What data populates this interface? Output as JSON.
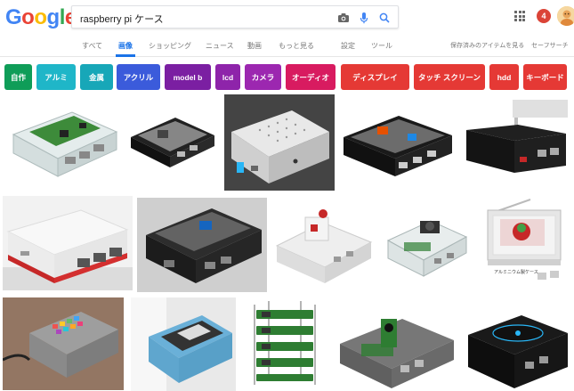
{
  "header": {
    "logo_letters": [
      {
        "char": "G",
        "color": "#4285F4"
      },
      {
        "char": "o",
        "color": "#EA4335"
      },
      {
        "char": "o",
        "color": "#FBBC05"
      },
      {
        "char": "g",
        "color": "#4285F4"
      },
      {
        "char": "l",
        "color": "#34A853"
      },
      {
        "char": "e",
        "color": "#EA4335"
      }
    ],
    "search_query": "raspberry pi ケース",
    "notification_count": "4"
  },
  "tabs": {
    "all": "すべて",
    "images": "画像",
    "shopping": "ショッピング",
    "news": "ニュース",
    "videos": "動画",
    "more": "もっと見る",
    "settings": "設定",
    "tools": "ツール",
    "saved": "保存済みのアイテムを見る",
    "safesearch": "セーフサーチ"
  },
  "chips": [
    {
      "label": "自作",
      "color": "#0f9d58"
    },
    {
      "label": "アルミ",
      "color": "#1fb6c8"
    },
    {
      "label": "金属",
      "color": "#17a7b8"
    },
    {
      "label": "アクリル",
      "color": "#3b5bdb"
    },
    {
      "label": "model b",
      "color": "#7b1fa2"
    },
    {
      "label": "lcd",
      "color": "#8e24aa"
    },
    {
      "label": "カメラ",
      "color": "#9c27b0"
    },
    {
      "label": "オーディオ",
      "color": "#d81b60"
    },
    {
      "label": "ディスプレイ",
      "color": "#e53935"
    },
    {
      "label": "タッチ スクリーン",
      "color": "#e53935"
    },
    {
      "label": "hdd",
      "color": "#e53935"
    },
    {
      "label": "キーボード",
      "color": "#e53935"
    }
  ],
  "image_caption": "アルミニウム製ケース",
  "colors": {
    "accent": "#1a73e8",
    "notification": "#db4437",
    "pi_green": "#2e7d32",
    "pi_red": "#c62828"
  }
}
